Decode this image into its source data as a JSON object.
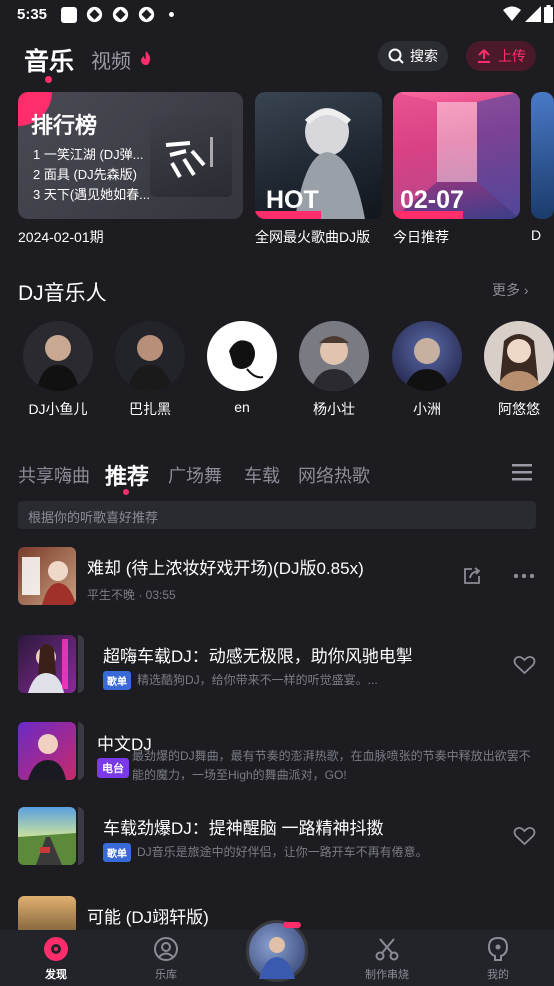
{
  "status": {
    "time": "5:35"
  },
  "header": {
    "tab_music": "音乐",
    "tab_video": "视频",
    "search": "搜索",
    "upload": "上传"
  },
  "cards": [
    {
      "tag": "排行榜",
      "items": [
        "1 一笑江湖 (DJ弹...",
        "2 面具 (DJ先森版)",
        "3 天下(遇见她如春..."
      ],
      "caption": "2024-02-01期"
    },
    {
      "tag": "HOT",
      "caption": "全网最火歌曲DJ版"
    },
    {
      "tag": "02-07",
      "caption": "今日推荐"
    },
    {
      "caption": "D"
    }
  ],
  "dj_section": {
    "title": "DJ音乐人",
    "more": "更多 ›"
  },
  "artists": [
    "DJ小鱼儿",
    "巴扎黑",
    "en",
    "杨小壮",
    "小洲",
    "阿悠悠"
  ],
  "categories": [
    "共享嗨曲",
    "推荐",
    "广场舞",
    "车载",
    "网络热歌"
  ],
  "recommend_hint": "根据你的听歌喜好推荐",
  "rows": [
    {
      "title": "难却 (待上浓妆好戏开场)(DJ版0.85x)",
      "sub": "平生不晚 · 03:55"
    },
    {
      "title": "超嗨车载DJ：动感无极限，助你风驰电掣",
      "tag": "歌单",
      "sub": "精选酷狗DJ，给你带来不一样的听觉盛宴。..."
    },
    {
      "title": "中文DJ",
      "tag": "电台",
      "sub": "最劲爆的DJ舞曲，最有节奏的澎湃热歌，在血脉喷张的节奏中释放出欲罢不能的魔力，一场至High的舞曲派对，GO!"
    },
    {
      "title": "车载劲爆DJ：提神醒脑  一路精神抖擞",
      "tag": "歌单",
      "sub": "DJ音乐是旅途中的好伴侣，让你一路开车不再有倦意。"
    },
    {
      "title": "可能 (DJ翊轩版)"
    }
  ],
  "nav": {
    "discover": "发现",
    "library": "乐库",
    "make": "制作串烧",
    "mine": "我的"
  },
  "colors": {
    "accent": "#ff2d6b",
    "background": "#1c1c21"
  }
}
